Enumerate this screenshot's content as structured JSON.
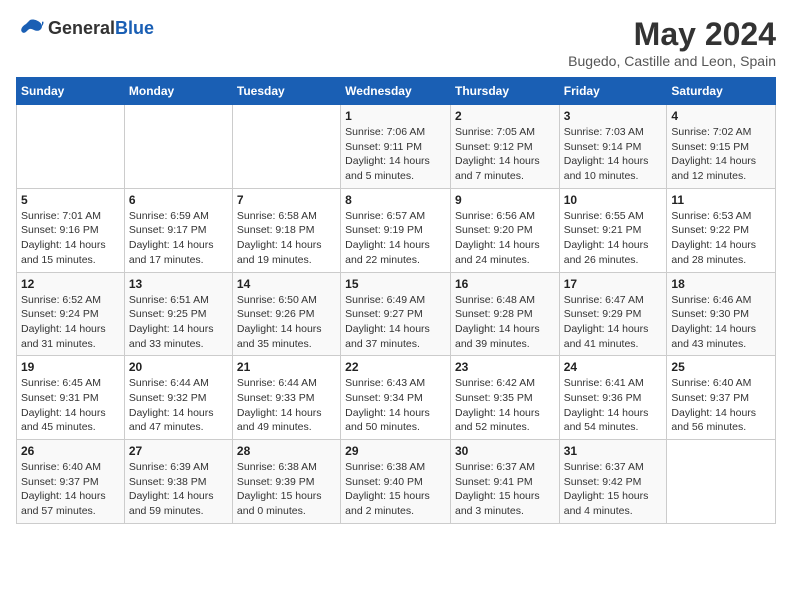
{
  "header": {
    "logo_general": "General",
    "logo_blue": "Blue",
    "month_year": "May 2024",
    "location": "Bugedo, Castille and Leon, Spain"
  },
  "days_of_week": [
    "Sunday",
    "Monday",
    "Tuesday",
    "Wednesday",
    "Thursday",
    "Friday",
    "Saturday"
  ],
  "weeks": [
    [
      {
        "day": "",
        "info": ""
      },
      {
        "day": "",
        "info": ""
      },
      {
        "day": "",
        "info": ""
      },
      {
        "day": "1",
        "info": "Sunrise: 7:06 AM\nSunset: 9:11 PM\nDaylight: 14 hours\nand 5 minutes."
      },
      {
        "day": "2",
        "info": "Sunrise: 7:05 AM\nSunset: 9:12 PM\nDaylight: 14 hours\nand 7 minutes."
      },
      {
        "day": "3",
        "info": "Sunrise: 7:03 AM\nSunset: 9:14 PM\nDaylight: 14 hours\nand 10 minutes."
      },
      {
        "day": "4",
        "info": "Sunrise: 7:02 AM\nSunset: 9:15 PM\nDaylight: 14 hours\nand 12 minutes."
      }
    ],
    [
      {
        "day": "5",
        "info": "Sunrise: 7:01 AM\nSunset: 9:16 PM\nDaylight: 14 hours\nand 15 minutes."
      },
      {
        "day": "6",
        "info": "Sunrise: 6:59 AM\nSunset: 9:17 PM\nDaylight: 14 hours\nand 17 minutes."
      },
      {
        "day": "7",
        "info": "Sunrise: 6:58 AM\nSunset: 9:18 PM\nDaylight: 14 hours\nand 19 minutes."
      },
      {
        "day": "8",
        "info": "Sunrise: 6:57 AM\nSunset: 9:19 PM\nDaylight: 14 hours\nand 22 minutes."
      },
      {
        "day": "9",
        "info": "Sunrise: 6:56 AM\nSunset: 9:20 PM\nDaylight: 14 hours\nand 24 minutes."
      },
      {
        "day": "10",
        "info": "Sunrise: 6:55 AM\nSunset: 9:21 PM\nDaylight: 14 hours\nand 26 minutes."
      },
      {
        "day": "11",
        "info": "Sunrise: 6:53 AM\nSunset: 9:22 PM\nDaylight: 14 hours\nand 28 minutes."
      }
    ],
    [
      {
        "day": "12",
        "info": "Sunrise: 6:52 AM\nSunset: 9:24 PM\nDaylight: 14 hours\nand 31 minutes."
      },
      {
        "day": "13",
        "info": "Sunrise: 6:51 AM\nSunset: 9:25 PM\nDaylight: 14 hours\nand 33 minutes."
      },
      {
        "day": "14",
        "info": "Sunrise: 6:50 AM\nSunset: 9:26 PM\nDaylight: 14 hours\nand 35 minutes."
      },
      {
        "day": "15",
        "info": "Sunrise: 6:49 AM\nSunset: 9:27 PM\nDaylight: 14 hours\nand 37 minutes."
      },
      {
        "day": "16",
        "info": "Sunrise: 6:48 AM\nSunset: 9:28 PM\nDaylight: 14 hours\nand 39 minutes."
      },
      {
        "day": "17",
        "info": "Sunrise: 6:47 AM\nSunset: 9:29 PM\nDaylight: 14 hours\nand 41 minutes."
      },
      {
        "day": "18",
        "info": "Sunrise: 6:46 AM\nSunset: 9:30 PM\nDaylight: 14 hours\nand 43 minutes."
      }
    ],
    [
      {
        "day": "19",
        "info": "Sunrise: 6:45 AM\nSunset: 9:31 PM\nDaylight: 14 hours\nand 45 minutes."
      },
      {
        "day": "20",
        "info": "Sunrise: 6:44 AM\nSunset: 9:32 PM\nDaylight: 14 hours\nand 47 minutes."
      },
      {
        "day": "21",
        "info": "Sunrise: 6:44 AM\nSunset: 9:33 PM\nDaylight: 14 hours\nand 49 minutes."
      },
      {
        "day": "22",
        "info": "Sunrise: 6:43 AM\nSunset: 9:34 PM\nDaylight: 14 hours\nand 50 minutes."
      },
      {
        "day": "23",
        "info": "Sunrise: 6:42 AM\nSunset: 9:35 PM\nDaylight: 14 hours\nand 52 minutes."
      },
      {
        "day": "24",
        "info": "Sunrise: 6:41 AM\nSunset: 9:36 PM\nDaylight: 14 hours\nand 54 minutes."
      },
      {
        "day": "25",
        "info": "Sunrise: 6:40 AM\nSunset: 9:37 PM\nDaylight: 14 hours\nand 56 minutes."
      }
    ],
    [
      {
        "day": "26",
        "info": "Sunrise: 6:40 AM\nSunset: 9:37 PM\nDaylight: 14 hours\nand 57 minutes."
      },
      {
        "day": "27",
        "info": "Sunrise: 6:39 AM\nSunset: 9:38 PM\nDaylight: 14 hours\nand 59 minutes."
      },
      {
        "day": "28",
        "info": "Sunrise: 6:38 AM\nSunset: 9:39 PM\nDaylight: 15 hours\nand 0 minutes."
      },
      {
        "day": "29",
        "info": "Sunrise: 6:38 AM\nSunset: 9:40 PM\nDaylight: 15 hours\nand 2 minutes."
      },
      {
        "day": "30",
        "info": "Sunrise: 6:37 AM\nSunset: 9:41 PM\nDaylight: 15 hours\nand 3 minutes."
      },
      {
        "day": "31",
        "info": "Sunrise: 6:37 AM\nSunset: 9:42 PM\nDaylight: 15 hours\nand 4 minutes."
      },
      {
        "day": "",
        "info": ""
      }
    ]
  ]
}
